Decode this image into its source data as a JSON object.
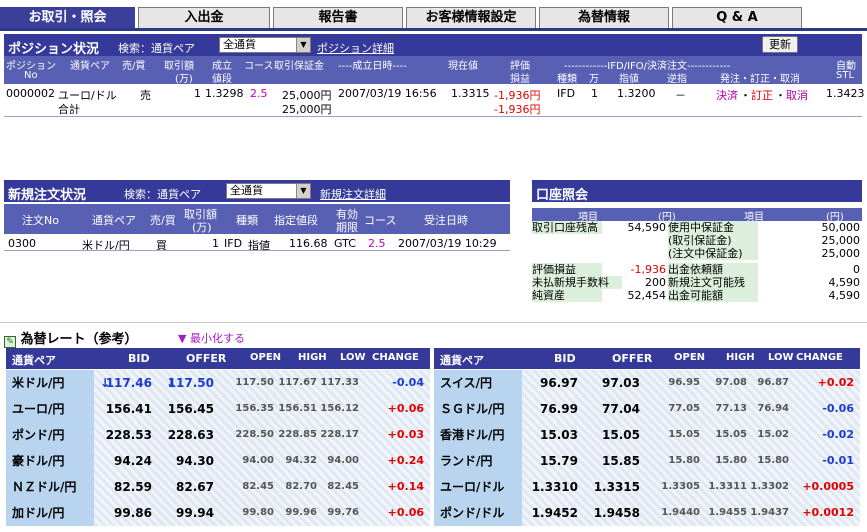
{
  "tabs": [
    "お取引・照会",
    "入出金",
    "報告書",
    "お客様情報設定",
    "為替情報",
    "Q & A"
  ],
  "position": {
    "title": "ポジション状況",
    "search_label": "検索：通貨ペア",
    "search_value": "全通貨",
    "detail_link": "ポジション詳細",
    "refresh_button": "更新",
    "headers": {
      "no_1": "ポジション",
      "no_2": "No",
      "pair": "通貨ペア",
      "side": "売/買",
      "qty_1": "取引額",
      "qty_2": "(万)",
      "rate_1": "成立",
      "rate_2": "値段",
      "cost": "コース",
      "margin": "取引保証金",
      "datetime": "----成立日時----",
      "current": "現在値",
      "pl_1": "評価",
      "pl_2": "損益",
      "ifd_banner": "------------IFD/IFO/決済注文------------",
      "kind": "種類",
      "man": "万",
      "limit": "指値",
      "stop": "逆指",
      "order_actions": "発注・訂正・取消",
      "auto_1": "自動",
      "auto_2": "STL"
    },
    "row": {
      "no": "0000002",
      "pair": "ユーロ/ドル",
      "side": "売",
      "qty": "1",
      "rate": "1.3298",
      "cost": "2.5",
      "margin": "25,000円",
      "datetime": "2007/03/19 16:56",
      "current": "1.3315",
      "pl": "-1,936円",
      "kind": "IFD",
      "man": "1",
      "limit": "1.3200",
      "stop": "－",
      "settle": "決済",
      "dot1": "・",
      "modify": "訂正",
      "dot2": "・",
      "cancel": "取消",
      "auto": "1.3423"
    },
    "total": {
      "label": "合計",
      "margin": "25,000円",
      "pl": "-1,936円"
    }
  },
  "new_orders": {
    "title": "新規注文状況",
    "search_label": "検索：通貨ペア",
    "search_value": "全通貨",
    "detail_link": "新規注文詳細",
    "headers": {
      "no": "注文No",
      "pair": "通貨ペア",
      "side": "売/買",
      "qty_1": "取引額",
      "qty_2": "(万)",
      "kind": "種類",
      "price": "指定値段",
      "valid_1": "有効",
      "valid_2": "期限",
      "cost": "コース",
      "datetime": "受注日時"
    },
    "row": {
      "no": "0300",
      "pair": "米ドル/円",
      "side": "買",
      "qty": "1",
      "kind": "IFD",
      "type": "指値",
      "price": "116.68",
      "valid": "GTC",
      "cost": "2.5",
      "datetime": "2007/03/19 10:29"
    }
  },
  "account": {
    "title": "口座照会",
    "headers": {
      "item_left": "項目",
      "unit_left": "(円)",
      "item_right": "項目",
      "unit_right": "(円)"
    },
    "left": [
      {
        "label": "取引口座残高",
        "value": "54,590"
      },
      {
        "label": "",
        "value": ""
      },
      {
        "label": "",
        "value": ""
      },
      {
        "label": "評価損益",
        "value": "-1,936"
      },
      {
        "label": "未払新規手数料",
        "value": "200"
      },
      {
        "label": "純資産",
        "value": "52,454"
      }
    ],
    "right": [
      {
        "label": "使用中保証金",
        "value": "50,000"
      },
      {
        "label": "(取引保証金)",
        "value": "25,000"
      },
      {
        "label": "(注文中保証金)",
        "value": "25,000"
      },
      {
        "label": "出金依頼額",
        "value": "0"
      },
      {
        "label": "新規注文可能残",
        "value": "4,590"
      },
      {
        "label": "出金可能額",
        "value": "4,590"
      }
    ]
  },
  "rates": {
    "title": "為替レート（参考）",
    "minimize": "最小化する",
    "headers": {
      "pair": "通貨ペア",
      "bid": "BID",
      "offer": "OFFER",
      "open": "OPEN",
      "high": "HIGH",
      "low": "LOW",
      "change": "CHANGE"
    },
    "left": [
      {
        "pair": "米ドル/円",
        "bid": "117.46",
        "offer": "117.50",
        "open": "117.50",
        "high": "117.67",
        "low": "117.33",
        "change": "-0.04",
        "arrow": "↓"
      },
      {
        "pair": "ユーロ/円",
        "bid": "156.41",
        "offer": "156.45",
        "open": "156.35",
        "high": "156.51",
        "low": "156.12",
        "change": "+0.06",
        "arrow": ""
      },
      {
        "pair": "ポンド/円",
        "bid": "228.53",
        "offer": "228.63",
        "open": "228.50",
        "high": "228.85",
        "low": "228.17",
        "change": "+0.03",
        "arrow": ""
      },
      {
        "pair": "豪ドル/円",
        "bid": "94.24",
        "offer": "94.30",
        "open": "94.00",
        "high": "94.32",
        "low": "94.00",
        "change": "+0.24",
        "arrow": ""
      },
      {
        "pair": "ＮＺドル/円",
        "bid": "82.59",
        "offer": "82.67",
        "open": "82.45",
        "high": "82.70",
        "low": "82.45",
        "change": "+0.14",
        "arrow": ""
      },
      {
        "pair": "加ドル/円",
        "bid": "99.86",
        "offer": "99.94",
        "open": "99.80",
        "high": "99.96",
        "low": "99.76",
        "change": "+0.06",
        "arrow": ""
      }
    ],
    "right": [
      {
        "pair": "スイス/円",
        "bid": "96.97",
        "offer": "97.03",
        "open": "96.95",
        "high": "97.08",
        "low": "96.87",
        "change": "+0.02"
      },
      {
        "pair": "ＳＧドル/円",
        "bid": "76.99",
        "offer": "77.04",
        "open": "77.05",
        "high": "77.13",
        "low": "76.94",
        "change": "-0.06"
      },
      {
        "pair": "香港ドル/円",
        "bid": "15.03",
        "offer": "15.05",
        "open": "15.05",
        "high": "15.05",
        "low": "15.02",
        "change": "-0.02"
      },
      {
        "pair": "ランド/円",
        "bid": "15.79",
        "offer": "15.85",
        "open": "15.80",
        "high": "15.80",
        "low": "15.80",
        "change": "-0.01"
      },
      {
        "pair": "ユーロ/ドル",
        "bid": "1.3310",
        "offer": "1.3315",
        "open": "1.3305",
        "high": "1.3311",
        "low": "1.3302",
        "change": "+0.0005"
      },
      {
        "pair": "ポンド/ドル",
        "bid": "1.9452",
        "offer": "1.9458",
        "open": "1.9440",
        "high": "1.9455",
        "low": "1.9437",
        "change": "+0.0012"
      }
    ]
  },
  "colors": {
    "header_blue": "#34399a",
    "pair_blue": "#b8d4ef",
    "negative": "#e00000",
    "link_purple": "#b000b0"
  }
}
